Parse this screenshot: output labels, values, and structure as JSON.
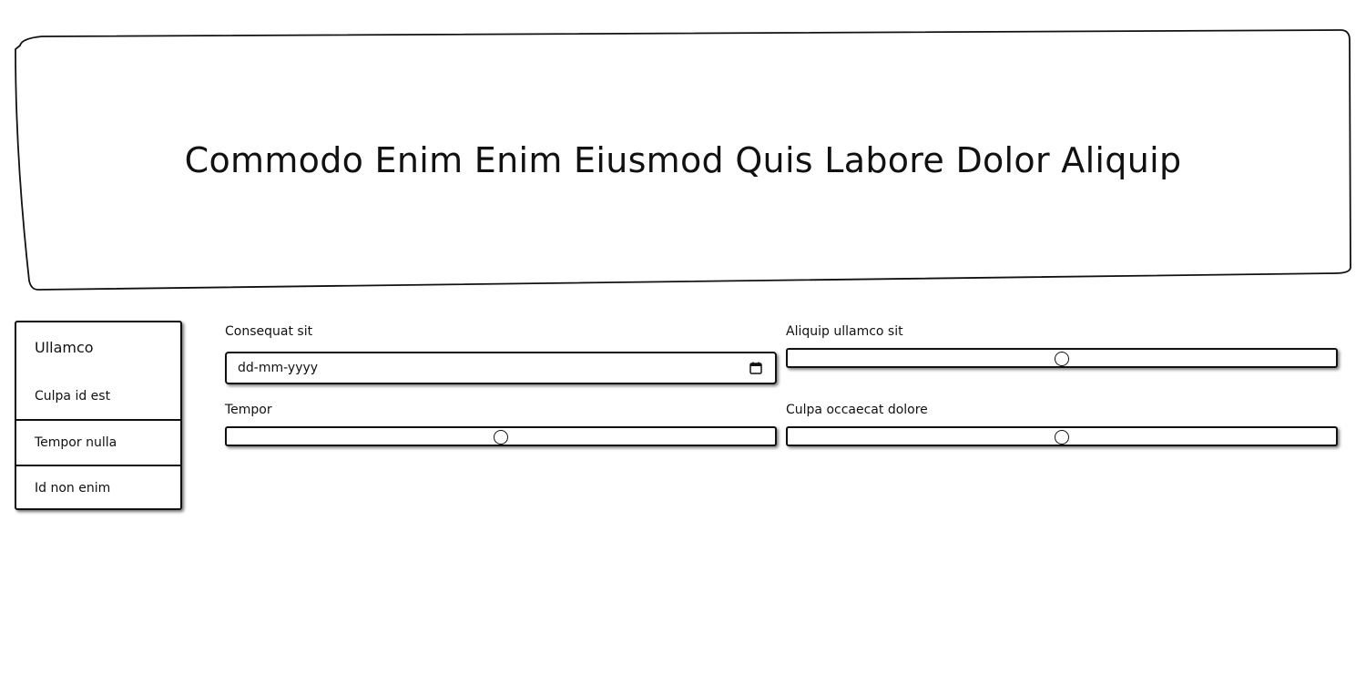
{
  "hero": {
    "title": "Commodo Enim Enim Eiusmod Quis Labore Dolor Aliquip"
  },
  "sidebar": {
    "heading": "Ullamco",
    "items": [
      {
        "label": "Culpa id est"
      },
      {
        "label": "Tempor nulla"
      },
      {
        "label": "Id non enim"
      }
    ]
  },
  "form": {
    "date_field": {
      "label": "Consequat sit",
      "placeholder": "dd-mm-yyyy",
      "icon": "calendar-icon"
    },
    "slider_1": {
      "label": "Aliquip ullamco sit",
      "value": 50,
      "min": 0,
      "max": 100
    },
    "slider_2": {
      "label": "Tempor",
      "value": 50,
      "min": 0,
      "max": 100
    },
    "slider_3": {
      "label": "Culpa occaecat dolore",
      "value": 50,
      "min": 0,
      "max": 100
    }
  }
}
